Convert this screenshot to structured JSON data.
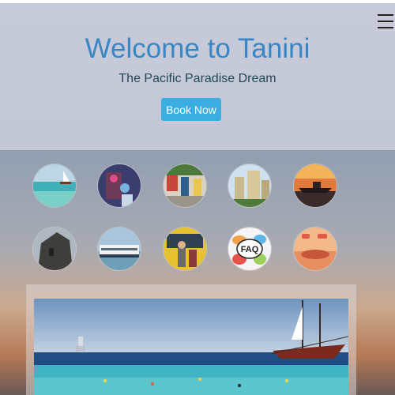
{
  "header": {
    "menu_icon": "hamburger-icon"
  },
  "hero": {
    "title": "Welcome to Tanini",
    "subtitle": "The Pacific Paradise Dream",
    "cta_label": "Book Now"
  },
  "gallery": {
    "row1": [
      "beach-sailboat",
      "flower-shop",
      "street-market",
      "hotel-towers",
      "sunset-boat"
    ],
    "row2": [
      "stone-fort",
      "cruise-ship",
      "bus-tour",
      "faq",
      "sunset-cards"
    ],
    "faq_label": "FAQ"
  },
  "colors": {
    "title": "#3a86c4",
    "subtitle": "#1f4756",
    "button": "#3aaee3",
    "hero_bg": "#c7cbd9"
  }
}
